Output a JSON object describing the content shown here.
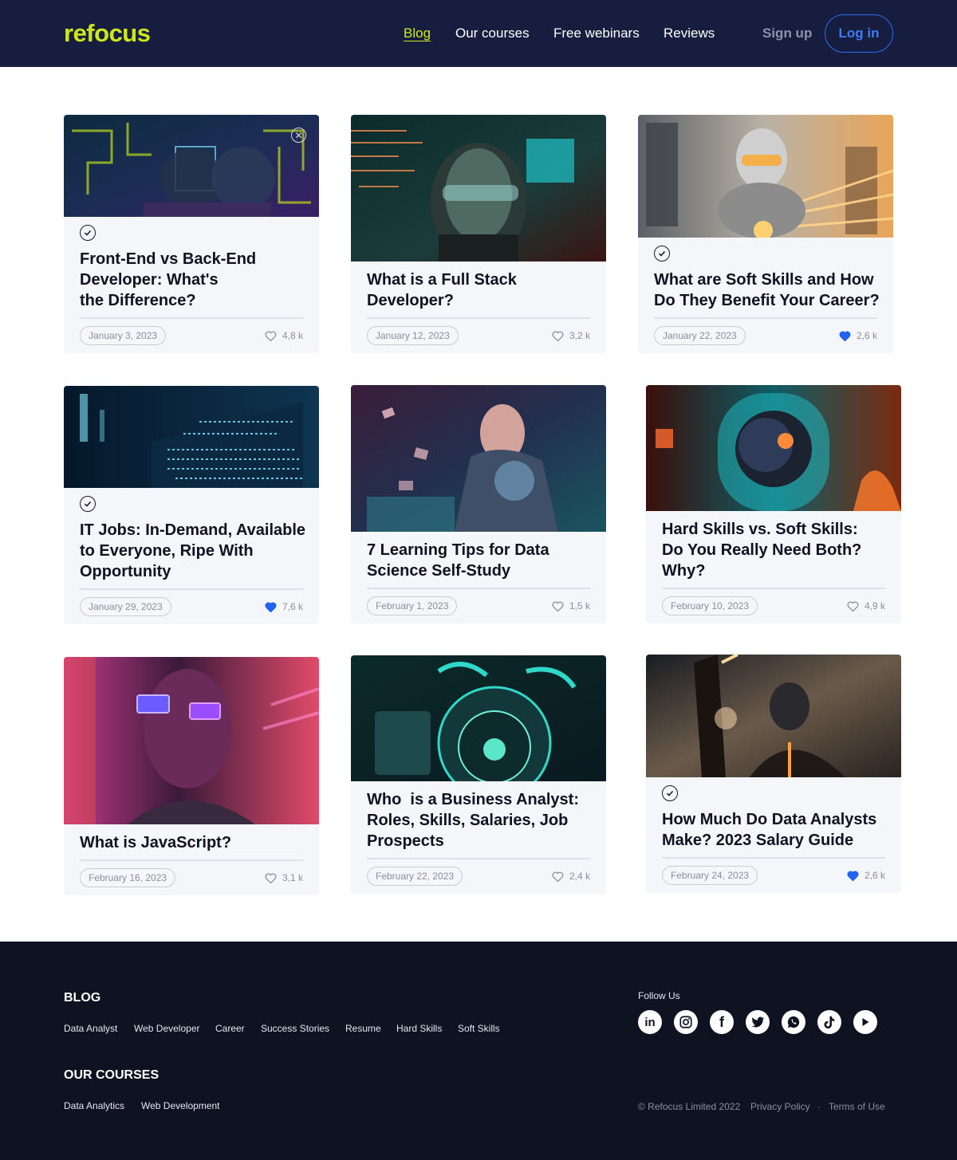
{
  "header": {
    "logo": "refocus",
    "nav": [
      "Blog",
      "Our courses",
      "Free webinars",
      "Reviews"
    ],
    "signup": "Sign up",
    "login": "Log in"
  },
  "colors": {
    "accent": "#cfe619",
    "header_bg": "#171d3f",
    "footer_bg": "#0f1221",
    "login_blue": "#2a6cf0",
    "liked_heart": "#1f63f0"
  },
  "cards": [
    {
      "title_lines": [
        "Front-End vs Back-End",
        "Developer: What's",
        "the Difference?"
      ],
      "date": "January 3, 2023",
      "likes": "4,8 k",
      "liked": false,
      "read": true
    },
    {
      "title_lines": [
        "What is a Full Stack",
        "Developer?"
      ],
      "date": "January 12, 2023",
      "likes": "3,2 k",
      "liked": false,
      "read": false
    },
    {
      "title_lines": [
        "What are Soft Skills and How",
        "Do They Benefit Your Career?"
      ],
      "date": "January 22, 2023",
      "likes": "2,6 k",
      "liked": true,
      "read": true
    },
    {
      "title_lines": [
        "IT Jobs: In-Demand, Available",
        "to Everyone, Ripe With",
        "Opportunity"
      ],
      "date": "January 29, 2023",
      "likes": "7,6 k",
      "liked": true,
      "read": true
    },
    {
      "title_lines": [
        "7 Learning Tips for Data",
        "Science Self-Study"
      ],
      "date": "February 1, 2023",
      "likes": "1,5 k",
      "liked": false,
      "read": false
    },
    {
      "title_lines": [
        "Hard Skills vs. Soft Skills:",
        "Do You Really Need Both?",
        "Why?"
      ],
      "date": "February 10, 2023",
      "likes": "4,9 k",
      "liked": false,
      "read": false
    },
    {
      "title_lines": [
        "What is JavaScript?"
      ],
      "date": "February 16, 2023",
      "likes": "3,1 k",
      "liked": false,
      "read": false
    },
    {
      "title_lines": [
        "Who  is a Business Analyst:",
        "Roles, Skills, Salaries, Job",
        "Prospects"
      ],
      "date": "February 22, 2023",
      "likes": "2,4 k",
      "liked": false,
      "read": false
    },
    {
      "title_lines": [
        "How Much Do Data Analysts",
        "Make? 2023 Salary Guide"
      ],
      "date": "February 24, 2023",
      "likes": "2,6 k",
      "liked": true,
      "read": true
    }
  ],
  "footer": {
    "blog_heading": "BLOG",
    "blog_links": [
      "Data Analyst",
      "Web Developer",
      "Career",
      "Success Stories",
      "Resume",
      "Hard Skills",
      "Soft Skills"
    ],
    "courses_heading": "OUR COURSES",
    "course_links": [
      "Data Analytics",
      "Web Development"
    ],
    "follow_label": "Follow Us",
    "social_icons": [
      "linkedin-icon",
      "instagram-icon",
      "facebook-icon",
      "twitter-icon",
      "whatsapp-icon",
      "tiktok-icon",
      "youtube-icon"
    ],
    "copyright": "© Refocus Limited 2022",
    "privacy": "Privacy Policy",
    "separator": "·",
    "terms": "Terms of Use"
  }
}
